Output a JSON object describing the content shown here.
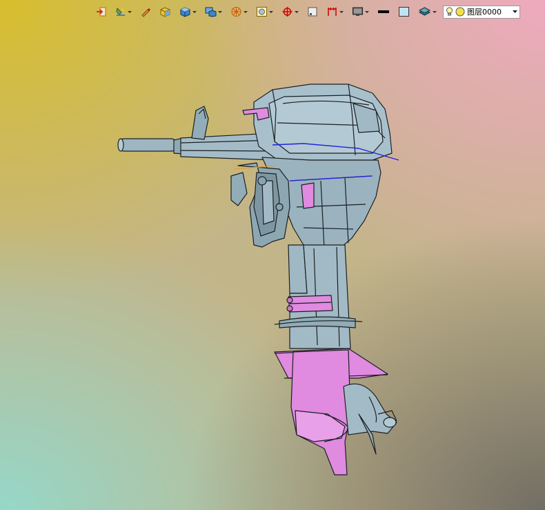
{
  "toolbar": {
    "buttons": [
      {
        "name": "exit-sketch",
        "icon": "import-arrow-icon",
        "has_dropdown": false
      },
      {
        "name": "paint",
        "icon": "paint-bucket-icon",
        "has_dropdown": true
      },
      {
        "name": "pen",
        "icon": "pencil-icon",
        "has_dropdown": false
      },
      {
        "name": "cube-yellow",
        "icon": "cube-edit-icon",
        "has_dropdown": false
      },
      {
        "name": "cube-blue",
        "icon": "cube-view-icon",
        "has_dropdown": true
      },
      {
        "name": "display-mode",
        "icon": "display-mode-icon",
        "has_dropdown": true
      },
      {
        "name": "render",
        "icon": "render-wheel-icon",
        "has_dropdown": true
      },
      {
        "name": "zoom",
        "icon": "zoom-fit-icon",
        "has_dropdown": true
      },
      {
        "name": "rotate",
        "icon": "rotate-target-icon",
        "has_dropdown": true
      },
      {
        "name": "section",
        "icon": "section-view-icon",
        "has_dropdown": false
      },
      {
        "name": "measure",
        "icon": "measure-icon",
        "has_dropdown": true
      },
      {
        "name": "screen",
        "icon": "screen-icon",
        "has_dropdown": true
      },
      {
        "name": "line-color",
        "icon": "line-color-icon",
        "has_dropdown": false
      },
      {
        "name": "fill-color",
        "icon": "fill-color-icon",
        "has_dropdown": false
      },
      {
        "name": "layers",
        "icon": "layers-icon",
        "has_dropdown": true
      }
    ],
    "layer": {
      "label": "图层0000",
      "visible_icon": "lightbulb-icon",
      "color_icon": "yellow-circle-icon",
      "dropdown_icon": "dropdown-arrow-icon"
    }
  },
  "colors": {
    "model_body": "#9fb8c3",
    "model_edge": "#1a1f23",
    "highlight": "#e08ae0",
    "accent_line": "#2222dd",
    "bg_top_left": "#d7be2d",
    "bg_top_right": "#eeaabe",
    "bg_bottom_left": "#96d7c8",
    "bg_bottom_right": "#736e64"
  },
  "viewport": {
    "model_name": "outboard-motor-model"
  }
}
